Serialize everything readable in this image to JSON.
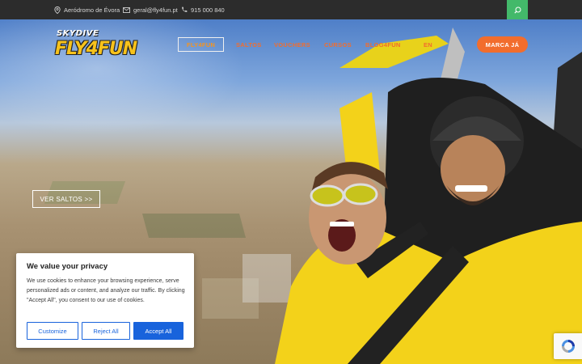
{
  "topbar": {
    "location": "Aeródromo de Évora",
    "email": "geral@fly4fun.pt",
    "phone": "915 000 840",
    "search_icon": "search-icon",
    "accent_color": "#43b96a"
  },
  "logo": {
    "line1": "SKYDIVE",
    "line2": "FLY4FUN"
  },
  "nav": {
    "items": [
      {
        "label": "FLY4FUN",
        "active": true
      },
      {
        "label": "SALTOS",
        "active": false
      },
      {
        "label": "VOUCHERS",
        "active": false
      },
      {
        "label": "CURSOS",
        "active": false
      },
      {
        "label": "BLOG4FUN",
        "active": false
      },
      {
        "label": "EN",
        "active": false
      }
    ],
    "cta_label": "MARCA JÁ",
    "accent_color": "#f26d2d"
  },
  "hero": {
    "button_label": "VER SALTOS >>"
  },
  "cookie": {
    "title": "We value your privacy",
    "body": "We use cookies to enhance your browsing experience, serve personalized ads or content, and analyze our traffic. By clicking \"Accept All\", you consent to our use of cookies.",
    "customize_label": "Customize",
    "reject_label": "Reject All",
    "accept_label": "Accept All",
    "button_color": "#1863dc"
  }
}
